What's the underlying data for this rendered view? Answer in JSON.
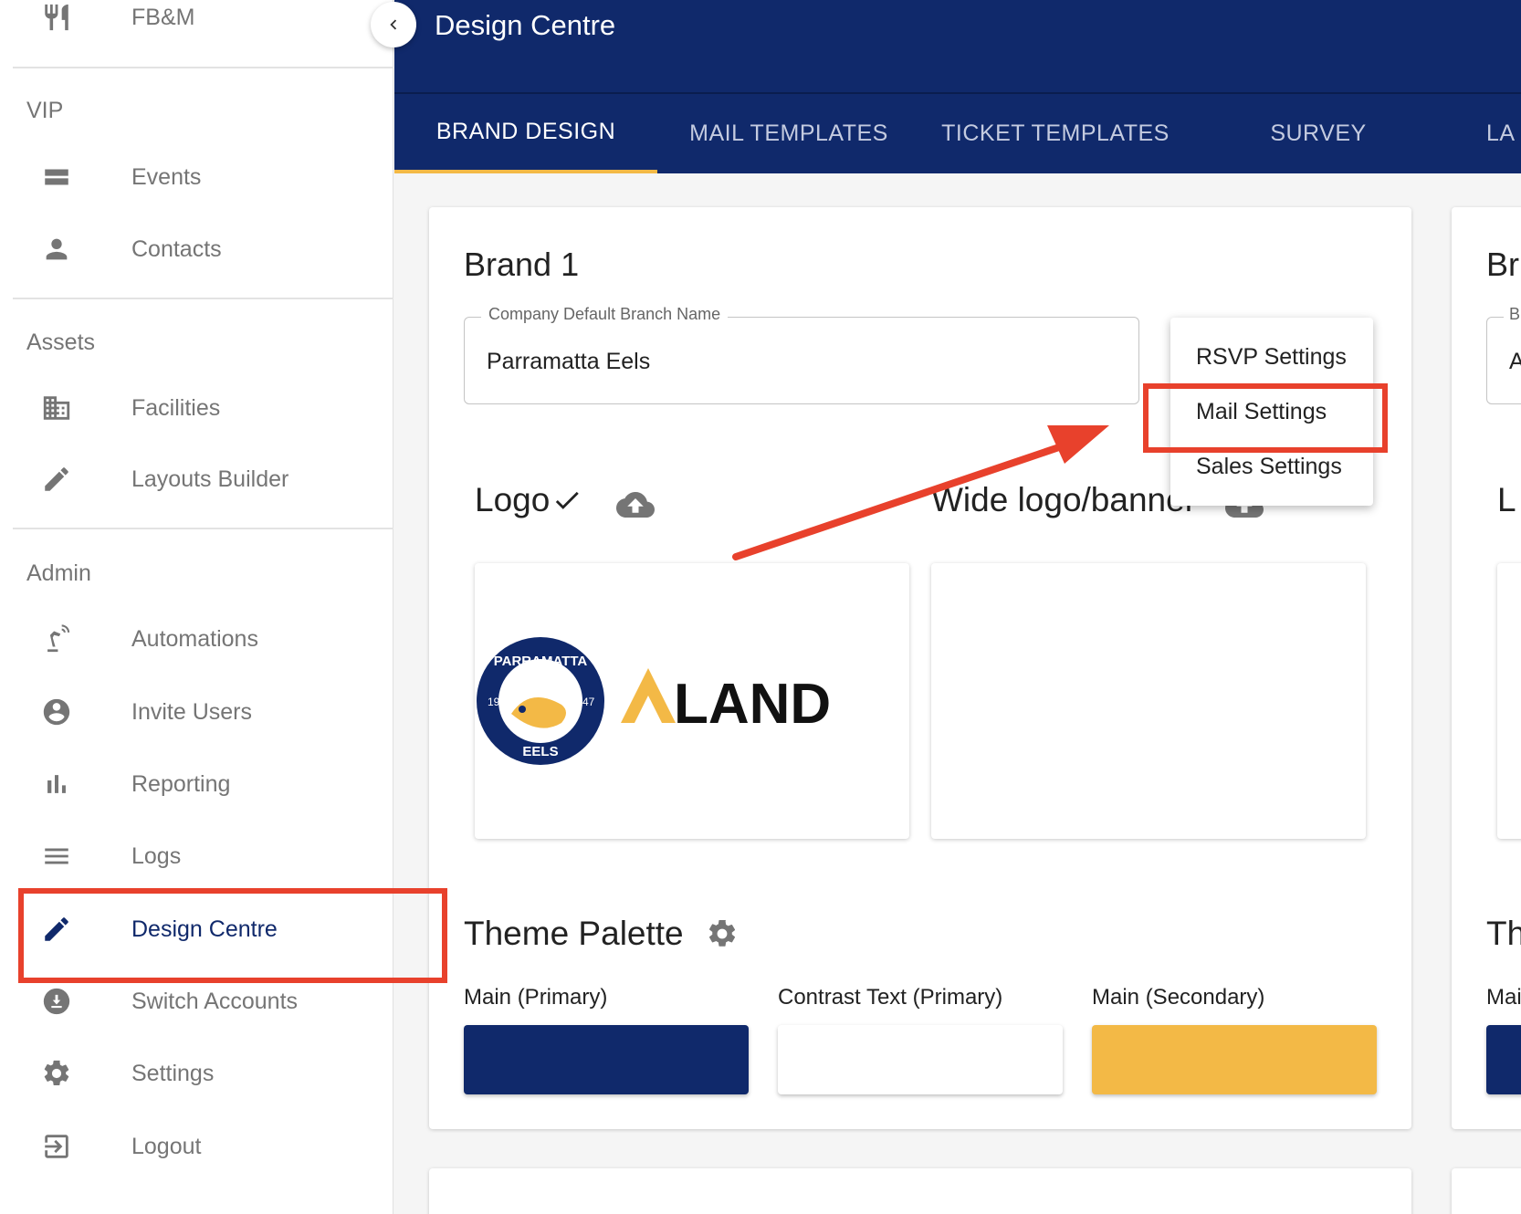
{
  "sidebar": {
    "top_item": {
      "label": "FB&M",
      "icon": "restaurant-icon"
    },
    "sections": {
      "vip": "VIP",
      "assets": "Assets",
      "admin": "Admin"
    },
    "items": [
      {
        "label": "Events",
        "icon": "events-icon"
      },
      {
        "label": "Contacts",
        "icon": "person-icon"
      },
      {
        "label": "Facilities",
        "icon": "building-icon"
      },
      {
        "label": "Layouts Builder",
        "icon": "pencil-icon"
      },
      {
        "label": "Automations",
        "icon": "robot-arm-icon"
      },
      {
        "label": "Invite Users",
        "icon": "account-circle-icon"
      },
      {
        "label": "Reporting",
        "icon": "bar-chart-icon"
      },
      {
        "label": "Logs",
        "icon": "menu-lines-icon"
      },
      {
        "label": "Design Centre",
        "icon": "pencil-icon",
        "active": true
      },
      {
        "label": "Switch Accounts",
        "icon": "switch-accounts-icon"
      },
      {
        "label": "Settings",
        "icon": "gear-icon"
      },
      {
        "label": "Logout",
        "icon": "logout-icon"
      }
    ]
  },
  "header": {
    "title": "Design Centre"
  },
  "tabs": [
    {
      "label": "BRAND DESIGN",
      "active": true
    },
    {
      "label": "MAIL TEMPLATES"
    },
    {
      "label": "TICKET TEMPLATES"
    },
    {
      "label": "SURVEY"
    },
    {
      "label": "LA"
    }
  ],
  "brand_card": {
    "title": "Brand 1",
    "branch_field": {
      "label": "Company Default Branch Name",
      "value": "Parramatta Eels"
    },
    "logo_heading": "Logo",
    "wide_logo_heading": "Wide logo/banner",
    "logo_text": {
      "seal_top": "PARRAMATTA",
      "seal_bottom": "EELS",
      "seal_left": "19",
      "seal_right": "47",
      "sponsor": "LAND"
    },
    "theme_title": "Theme Palette",
    "swatches": [
      {
        "label": "Main (Primary)",
        "color": "#10296b"
      },
      {
        "label": "Contrast Text (Primary)",
        "color": "#ffffff"
      },
      {
        "label": "Main (Secondary)",
        "color": "#f3b946"
      }
    ]
  },
  "second_card": {
    "title": "Br",
    "field_label": "B",
    "field_value": "A",
    "logo_heading": "L",
    "theme_title": "Th",
    "swatch_label": "Mai",
    "swatch_color": "#10296b"
  },
  "settings_menu": {
    "items": [
      "RSVP Settings",
      "Mail Settings",
      "Sales Settings"
    ]
  },
  "colors": {
    "primary": "#10296b",
    "secondary": "#f3b946",
    "annotation": "#e8412c"
  }
}
